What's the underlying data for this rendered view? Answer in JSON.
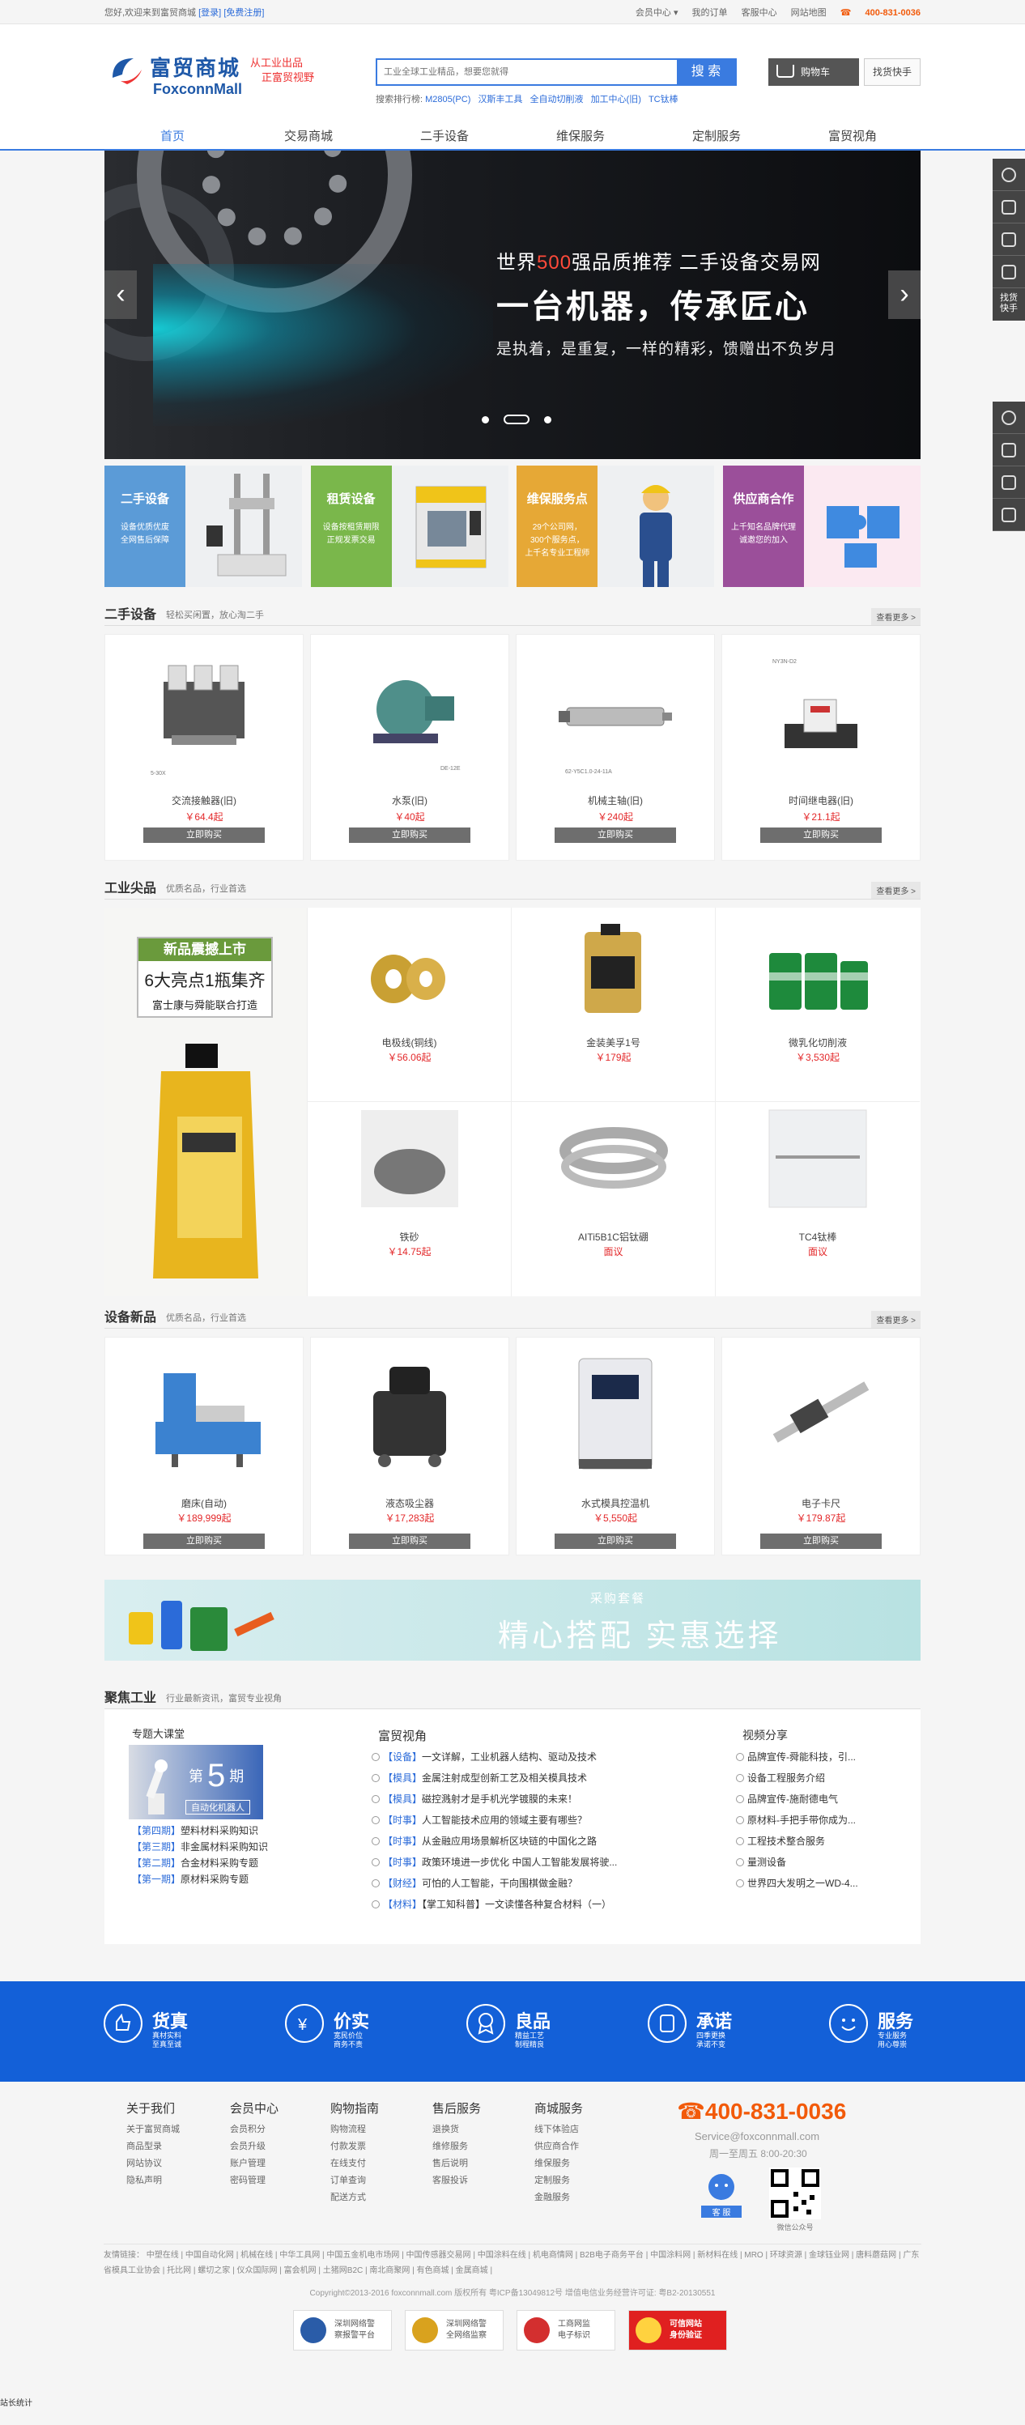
{
  "topbar": {
    "welcome": "您好,欢迎来到富贸商城",
    "login": "[登录]",
    "register": "[免费注册]",
    "member": "会员中心 ▾",
    "orders": "我的订单",
    "service": "客服中心",
    "sitemap": "网站地图",
    "phone": "400-831-0036"
  },
  "logo": {
    "cn": "富贸商城",
    "en": "FoxconnMall",
    "slogan1": "从工业出品",
    "slogan2": "正富贸视野"
  },
  "search": {
    "placeholder": "工业全球工业精品，想要您就得",
    "button": "搜 索",
    "hot_label": "搜索排行榜:",
    "hot": [
      "M2805(PC)",
      "汉斯丰工具",
      "全自动切削液",
      "加工中心(旧)",
      "TC钛棒"
    ]
  },
  "header": {
    "cart": "购物车",
    "find": "找货快手"
  },
  "nav": [
    "首页",
    "交易商城",
    "二手设备",
    "维保服务",
    "定制服务",
    "富贸视角"
  ],
  "banner": {
    "line1a": "世界",
    "line1b": "500",
    "line1c": "强品质推荐   二手设备交易网",
    "line2": "一台机器，传承匠心",
    "line3": "是执着，是重复，一样的精彩，馈赠出不负岁月",
    "prev": "‹",
    "next": "›"
  },
  "categories": [
    {
      "title": "二手设备",
      "sub": "设备优质优废\n全网售后保障",
      "color": "#5b9bd7"
    },
    {
      "title": "租赁设备",
      "sub": "设备按租赁期限\n正规发票交易",
      "color": "#7ab74b"
    },
    {
      "title": "维保服务点",
      "sub": "29个公司网，\n300个服务点，\n上千名专业工程师",
      "color": "#e6a836"
    },
    {
      "title": "供应商合作",
      "sub": "上千知名品牌代理\n诚邀您的加入",
      "color": "#9b4f9a"
    }
  ],
  "section1": {
    "title": "二手设备",
    "sub": "轻松买闲置，放心淘二手",
    "more": "查看更多 >",
    "items": [
      {
        "name": "交流接触器(旧)",
        "price": "￥64.4起",
        "buy": "立即购买",
        "tag": "5-30X"
      },
      {
        "name": "水泵(旧)",
        "price": "￥40起",
        "buy": "立即购买",
        "tag": "DE-12E"
      },
      {
        "name": "机械主轴(旧)",
        "price": "￥240起",
        "buy": "立即购买",
        "tag": "62-Y5C1.0-24-11A"
      },
      {
        "name": "时间继电器(旧)",
        "price": "￥21.1起",
        "buy": "立即购买",
        "tag": "NY3N-D2"
      }
    ]
  },
  "section2": {
    "title": "工业尖品",
    "sub": "优质名品，行业首选",
    "more": "查看更多 >",
    "ad": {
      "line1": "新品震撼上市",
      "line2": "6大亮点1瓶集齐",
      "line3": "富士康与舜能联合打造"
    },
    "items": [
      {
        "name": "电极线(铜线)",
        "price": "￥56.06起"
      },
      {
        "name": "金装美孚1号",
        "price": "￥179起"
      },
      {
        "name": "微乳化切削液",
        "price": "￥3,530起"
      },
      {
        "name": "铁砂",
        "price": "￥14.75起"
      },
      {
        "name": "AITi5B1C铝钛硼",
        "price": "面议"
      },
      {
        "name": "TC4钛棒",
        "price": "面议"
      }
    ]
  },
  "section3": {
    "title": "设备新品",
    "sub": "优质名品，行业首选",
    "more": "查看更多 >",
    "items": [
      {
        "name": "磨床(自动)",
        "price": "￥189,999起",
        "buy": "立即购买"
      },
      {
        "name": "液态吸尘器",
        "price": "￥17,283起",
        "buy": "立即购买"
      },
      {
        "name": "水式模具控温机",
        "price": "￥5,550起",
        "buy": "立即购买"
      },
      {
        "name": "电子卡尺",
        "price": "￥179.87起",
        "buy": "立即购买"
      }
    ]
  },
  "promo": {
    "tag": "采购套餐",
    "text": "精心搭配  实惠选择"
  },
  "news": {
    "title": "聚焦工业",
    "sub": "行业最新资讯，富贸专业视角",
    "lecture": {
      "title": "专题大课堂",
      "issue_pre": "第",
      "issue_no": "5",
      "issue_post": "期",
      "topic": "自动化机器人",
      "list": [
        {
          "tag": "【第四期】",
          "text": "塑料材料采购知识"
        },
        {
          "tag": "【第三期】",
          "text": "非金属材料采购知识"
        },
        {
          "tag": "【第二期】",
          "text": "合金材料采购专题"
        },
        {
          "tag": "【第一期】",
          "text": "原材料采购专题"
        }
      ]
    },
    "view_title": "富贸视角",
    "view": [
      {
        "tag": "【设备】",
        "text": "一文详解，工业机器人结构、驱动及技术"
      },
      {
        "tag": "【模具】",
        "text": "金属注射成型创新工艺及相关模具技术"
      },
      {
        "tag": "【模具】",
        "text": "磁控溅射才是手机光学镀膜的未来！"
      },
      {
        "tag": "【时事】",
        "text": "人工智能技术应用的领域主要有哪些？"
      },
      {
        "tag": "【时事】",
        "text": "从金融应用场景解析区块链的中国化之路"
      },
      {
        "tag": "【时事】",
        "text": "政策环境进一步优化 中国人工智能发展将驶..."
      },
      {
        "tag": "【财经】",
        "text": "可怕的人工智能，干向围棋做金融？"
      },
      {
        "tag": "【材料】",
        "text": "【掌工知科普】一文读懂各种复合材料（一）"
      }
    ],
    "video_title": "视频分享",
    "video": [
      "品牌宣传-舜能科技，引...",
      "设备工程服务介绍",
      "品牌宣传-施耐德电气",
      "原材料-手把手带你成为...",
      "工程技术整合服务",
      "量测设备",
      "世界四大发明之一WD-4..."
    ]
  },
  "service": [
    {
      "title": "货真",
      "sub": "真材实料\n至真至诚"
    },
    {
      "title": "价实",
      "sub": "宽民价位\n商务不责"
    },
    {
      "title": "良品",
      "sub": "精益工艺\n制程精良"
    },
    {
      "title": "承诺",
      "sub": "四季更换\n承诺不变"
    },
    {
      "title": "服务",
      "sub": "专业服务\n用心尊崇"
    }
  ],
  "footer": {
    "cols": [
      {
        "title": "关于我们",
        "items": [
          "关于富贸商城",
          "商品型录",
          "网站协议",
          "隐私声明"
        ]
      },
      {
        "title": "会员中心",
        "items": [
          "会员积分",
          "会员升级",
          "账户管理",
          "密码管理"
        ]
      },
      {
        "title": "购物指南",
        "items": [
          "购物流程",
          "付款发票",
          "在线支付",
          "订单查询",
          "配送方式"
        ]
      },
      {
        "title": "售后服务",
        "items": [
          "退换货",
          "维修服务",
          "售后说明",
          "客服投诉"
        ]
      },
      {
        "title": "商城服务",
        "items": [
          "线下体验店",
          "供应商合作",
          "维保服务",
          "定制服务",
          "金融服务"
        ]
      }
    ],
    "phone": "400-831-0036",
    "email": "Service@foxconnmall.com",
    "hours": "周一至周五 8:00-20:30",
    "kefu": "客 服",
    "wechat": "微信公众号",
    "links": "友情链接： 中塑在线 | 中国自动化网 | 机械在线 | 中华工具网 | 中国五金机电市场网 | 中国传感器交易网 | 中国涂料在线 | 机电商情网 | B2B电子商务平台 | 中国涂料网 | 新材料在线 | MRO | 环球资源 | 金球钰业网 | 唐料蘑菇网 | 广东省模具工业协会 | 托比网 | 螺切之家 | 仪众国际网 | 富会机网 | 土猪网B2C | 南北商聚网 | 有色商城 | 金属商城 |",
    "copyright": "Copyright©2013-2016 foxconnmall.com 版权所有 粤ICP备13049812号 增值电信业务经营许可证: 粤B2-20130551",
    "badges": [
      {
        "l1": "深圳网络警",
        "l2": "察报警平台"
      },
      {
        "l1": "深圳网络警",
        "l2": "全网络监察"
      },
      {
        "l1": "工商网监",
        "l2": "电子标识"
      },
      {
        "l1": "可信网站",
        "l2": "身份验证"
      }
    ],
    "stat": "站长统计"
  },
  "side": {
    "quick": "找货快手"
  },
  "colors": {
    "primary": "#3a7be0",
    "price": "#e3282a",
    "phone": "#f25a0a",
    "service": "#1360d8"
  }
}
